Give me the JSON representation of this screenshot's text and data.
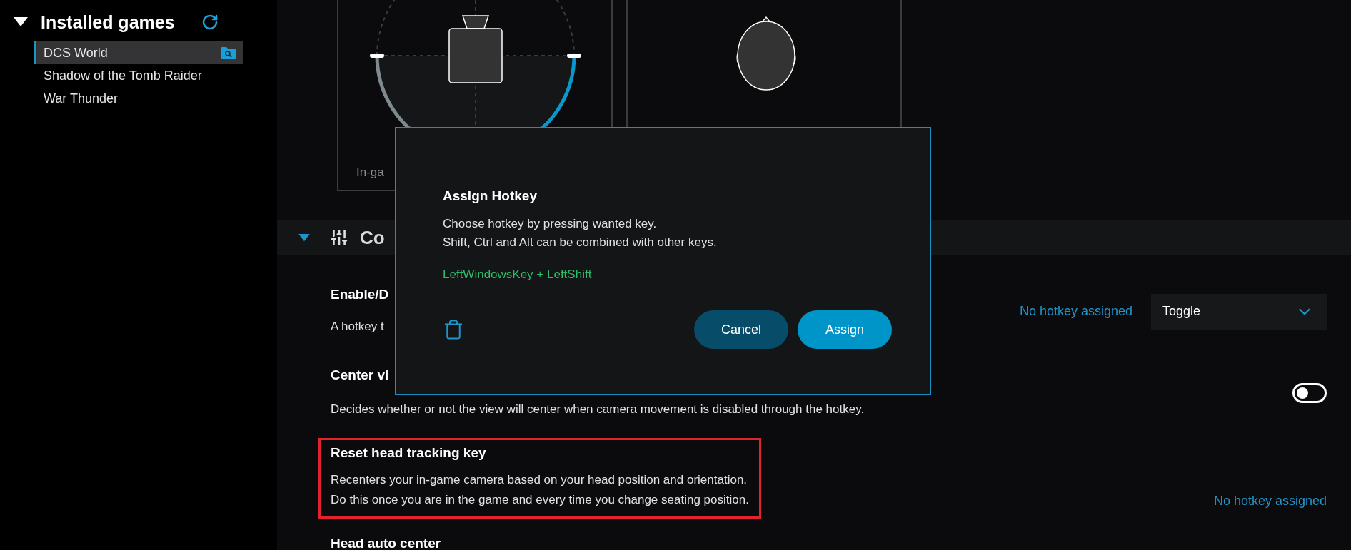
{
  "sidebar": {
    "title": "Installed games",
    "expanded": true,
    "games": [
      {
        "name": "DCS World",
        "selected": true
      },
      {
        "name": "Shadow of the Tomb Raider",
        "selected": false
      },
      {
        "name": "War Thunder",
        "selected": false
      }
    ]
  },
  "preview": {
    "panels": [
      {
        "kind": "camera",
        "caption": "In-ga"
      },
      {
        "kind": "head"
      }
    ]
  },
  "section": {
    "title": "Co",
    "expanded": true
  },
  "settings": [
    {
      "kind": "hotkey_mode",
      "title": "Enable/D",
      "description": "A hotkey t",
      "hotkey": "No hotkey assigned",
      "mode": "Toggle"
    },
    {
      "kind": "toggle",
      "title": "Center vi",
      "description": "Decides whether or not the view will center when camera movement is disabled through the hotkey.",
      "on": false
    },
    {
      "kind": "hotkey",
      "title": "Reset head tracking key",
      "description": "Recenters your in-game camera based on your head position and orientation.\nDo this once you are in the game and every time you change seating position.",
      "hotkey": "No hotkey assigned",
      "highlighted": true
    },
    {
      "kind": "heading",
      "title": "Head auto center"
    }
  ],
  "dialog": {
    "title": "Assign Hotkey",
    "text": "Choose hotkey by pressing wanted key.\nShift, Ctrl and Alt can be combined with other keys.",
    "combination": "LeftWindowsKey + LeftShift",
    "buttons": [
      {
        "label": "Cancel",
        "kind": "secondary"
      },
      {
        "label": "Assign",
        "kind": "primary"
      }
    ]
  }
}
